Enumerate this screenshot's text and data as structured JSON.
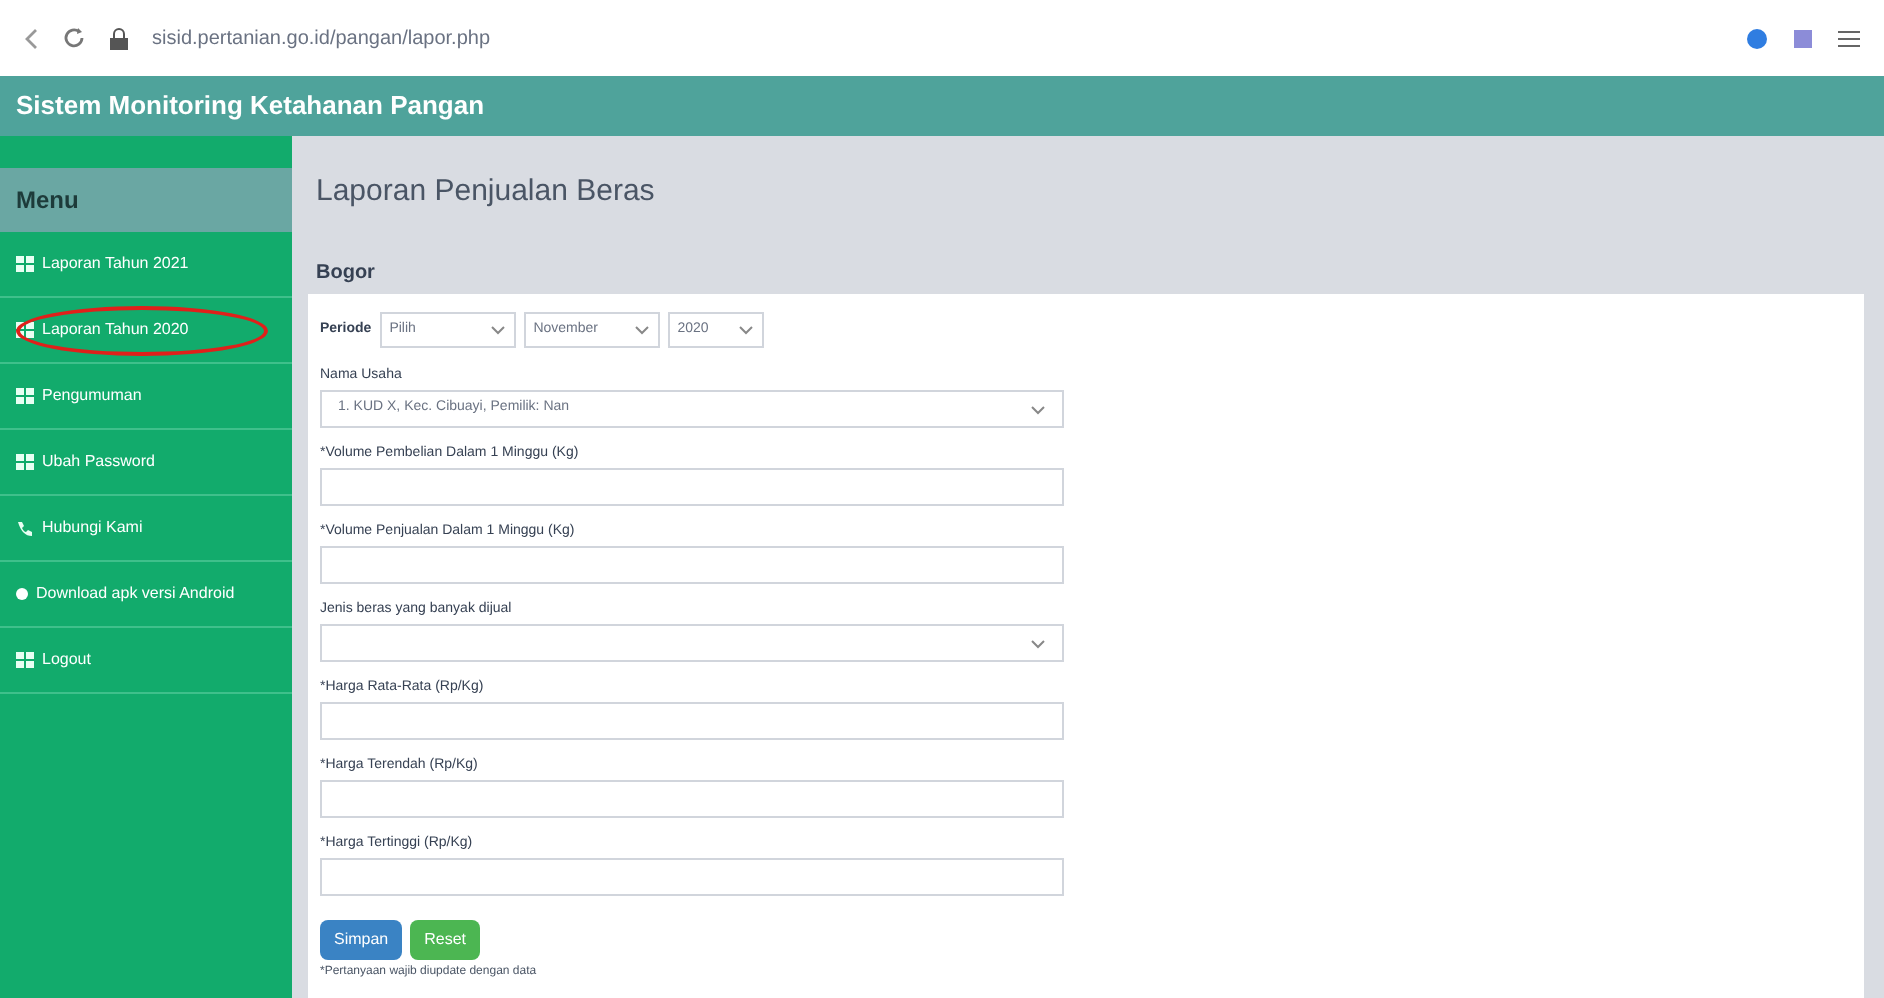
{
  "browser": {
    "url": "sisid.pertanian.go.id/pangan/lapor.php"
  },
  "header": {
    "title": "Sistem Monitoring Ketahanan Pangan"
  },
  "sidebar": {
    "title": "Menu",
    "items": [
      {
        "label": "Laporan Tahun 2021",
        "kind": "grid",
        "highlighted": false
      },
      {
        "label": "Laporan Tahun 2020",
        "kind": "grid",
        "highlighted": true
      },
      {
        "label": "Pengumuman",
        "kind": "grid",
        "highlighted": false
      },
      {
        "label": "Ubah Password",
        "kind": "grid",
        "highlighted": false
      },
      {
        "label": "Hubungi Kami",
        "kind": "phone",
        "highlighted": false
      },
      {
        "label": "Download apk versi Android",
        "kind": "dot",
        "highlighted": false
      },
      {
        "label": "Logout",
        "kind": "grid",
        "highlighted": false
      }
    ]
  },
  "page": {
    "title": "Laporan Penjualan Beras",
    "subtitle": "Bogor"
  },
  "form": {
    "period_label": "Periode",
    "period_selects": [
      "Pilih",
      "November",
      "2020"
    ],
    "fields": [
      {
        "kind": "select",
        "label": "Nama Usaha",
        "value": "1. KUD X, Kec. Cibuayi, Pemilik: Nan"
      },
      {
        "kind": "input",
        "label": "*Volume Pembelian Dalam 1 Minggu (Kg)"
      },
      {
        "kind": "input",
        "label": "*Volume Penjualan Dalam 1 Minggu (Kg)"
      },
      {
        "kind": "select",
        "label": "Jenis beras yang banyak dijual"
      },
      {
        "kind": "input",
        "label": "*Harga Rata-Rata (Rp/Kg)"
      },
      {
        "kind": "input",
        "label": "*Harga Terendah (Rp/Kg)"
      },
      {
        "kind": "input",
        "label": "*Harga Tertinggi (Rp/Kg)"
      }
    ],
    "buttons": [
      {
        "label": "Simpan",
        "kind": "primary"
      },
      {
        "label": "Reset",
        "kind": "success"
      }
    ],
    "note": "*Pertanyaan wajib diupdate dengan data"
  }
}
